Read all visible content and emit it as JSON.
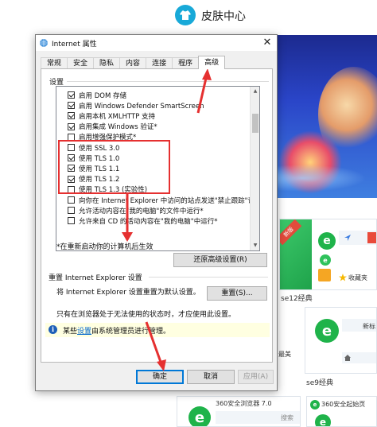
{
  "background": {
    "skin_center_title": "皮肤中心",
    "thumbs": [
      {
        "caption": "se12经典",
        "badge": "新版",
        "bar_text": "收藏夹"
      },
      {
        "caption": "se9经典",
        "bar_text": "新标"
      },
      {
        "small_title": "360安全浏览器 7.0",
        "search_text": "搜索"
      },
      {
        "small_title": "360安全起始页"
      }
    ],
    "partial_text": "最美"
  },
  "dialog": {
    "title": "Internet 属性",
    "close_symbol": "✕",
    "tabs": [
      "常规",
      "安全",
      "隐私",
      "内容",
      "连接",
      "程序",
      "高级"
    ],
    "active_tab": "高级",
    "settings_label": "设置",
    "settings": [
      {
        "label": "启用 DOM 存储",
        "checked": true
      },
      {
        "label": "启用 Windows Defender SmartScreen",
        "checked": true
      },
      {
        "label": "启用本机 XMLHTTP 支持",
        "checked": true
      },
      {
        "label": "启用集成 Windows 验证*",
        "checked": true
      },
      {
        "label": "启用增强保护模式*",
        "checked": false
      },
      {
        "label": "使用 SSL 3.0",
        "checked": false
      },
      {
        "label": "使用 TLS 1.0",
        "checked": true
      },
      {
        "label": "使用 TLS 1.1",
        "checked": true
      },
      {
        "label": "使用 TLS 1.2",
        "checked": true
      },
      {
        "label": "使用 TLS 1.3 (实验性)",
        "checked": false
      },
      {
        "label": "向你在 Internet Explorer 中访问的站点发送\"禁止跟踪\"请求*",
        "checked": false
      },
      {
        "label": "允许活动内容在\"我的电脑\"的文件中运行*",
        "checked": false
      },
      {
        "label": "允许来自 CD 的活动内容在\"我的电脑\"中运行*",
        "checked": false
      }
    ],
    "restart_note": "*在重新启动你的计算机后生效",
    "restore_button": "还原高级设置(R)",
    "reset_group_label": "重置 Internet Explorer 设置",
    "reset_desc": "将 Internet Explorer 设置重置为默认设置。",
    "reset_button": "重置(S)...",
    "reset_note": "只有在浏览器处于无法使用的状态时，才应使用此设置。",
    "info_prefix": "某些",
    "info_link": "设置",
    "info_suffix": "由系统管理员进行管理。",
    "ok_button": "确定",
    "cancel_button": "取消",
    "apply_button": "应用(A)"
  },
  "colors": {
    "annotation_red": "#e53030",
    "default_button_border": "#0078d7",
    "info_bar": "#ffffe1",
    "brand_blue": "#18a9d8",
    "green": "#1fb34a"
  }
}
